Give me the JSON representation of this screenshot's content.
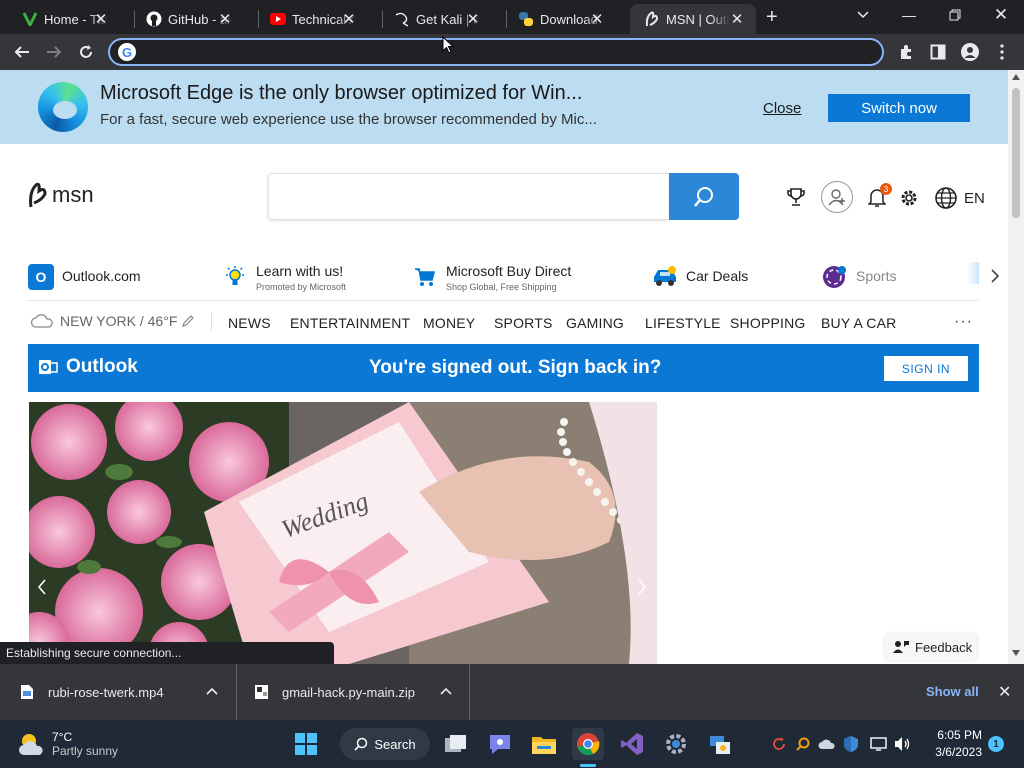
{
  "tabs": [
    {
      "title": "Home - Tita",
      "icon": "vim-icon"
    },
    {
      "title": "GitHub - ak",
      "icon": "github-icon"
    },
    {
      "title": "Technical A",
      "icon": "youtube-icon"
    },
    {
      "title": "Get Kali | K",
      "icon": "kali-icon"
    },
    {
      "title": "Download",
      "icon": "python-icon"
    },
    {
      "title": "MSN | Outl",
      "icon": "msn-icon",
      "active": true
    }
  ],
  "toolbar": {
    "url": ""
  },
  "edge_banner": {
    "title": "Microsoft Edge is the only browser optimized for Win...",
    "subtitle": "For a fast, secure web experience use the browser recommended by Mic...",
    "close_label": "Close",
    "switch_label": "Switch now"
  },
  "msn": {
    "logo_text": "msn",
    "search_placeholder": "",
    "notification_count": "3",
    "language": "EN"
  },
  "quicklinks": [
    {
      "label": "Outlook.com",
      "sub": "",
      "icon": "outlook-icon"
    },
    {
      "label": "Learn with us!",
      "sub": "Promoted by Microsoft",
      "icon": "lightbulb-icon"
    },
    {
      "label": "Microsoft Buy Direct",
      "sub": "Shop Global, Free Shipping",
      "icon": "cart-icon"
    },
    {
      "label": "Car Deals",
      "sub": "",
      "icon": "car-icon"
    },
    {
      "label": "Sports",
      "sub": "",
      "icon": "sports-icon"
    }
  ],
  "weather": {
    "location": "NEW YORK / 46°F"
  },
  "nav": [
    "NEWS",
    "ENTERTAINMENT",
    "MONEY",
    "SPORTS",
    "GAMING",
    "LIFESTYLE",
    "SHOPPING",
    "BUY A CAR"
  ],
  "outlook_bar": {
    "brand": "Outlook",
    "message": "You're signed out. Sign back in?",
    "button": "SIGN IN"
  },
  "hero": {
    "card_text": "Wedding"
  },
  "feedback_label": "Feedback",
  "status_text": "Establishing secure connection...",
  "downloads": {
    "items": [
      {
        "name": "rubi-rose-twerk.mp4"
      },
      {
        "name": "gmail-hack.py-main.zip"
      }
    ],
    "show_all": "Show all"
  },
  "taskbar": {
    "temperature": "7°C",
    "weather_desc": "Partly sunny",
    "search_label": "Search",
    "time": "6:05 PM",
    "date": "3/6/2023",
    "notification_badge": "1"
  },
  "colors": {
    "accent": "#0a78d4",
    "chrome_dark": "#202124",
    "chrome_toolbar": "#35363a",
    "banner_bg": "#bcdcf2"
  }
}
